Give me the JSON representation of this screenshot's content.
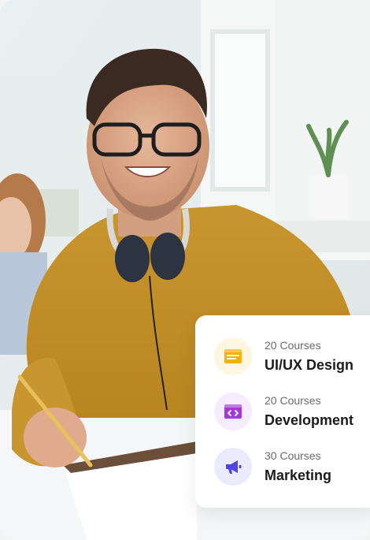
{
  "photo": {
    "subject": "student-with-headphones-photo"
  },
  "courses": [
    {
      "count": "20 Courses",
      "title": "UI/UX Design",
      "icon": "layout-window-icon",
      "badge_color": "#fff6e2",
      "icon_color": "#f2b10b"
    },
    {
      "count": "20 Courses",
      "title": "Development",
      "icon": "code-window-icon",
      "badge_color": "#f7ebff",
      "icon_color": "#a13bd6"
    },
    {
      "count": "30 Courses",
      "title": "Marketing",
      "icon": "megaphone-icon",
      "badge_color": "#eceaff",
      "icon_color": "#4f46e5"
    }
  ]
}
